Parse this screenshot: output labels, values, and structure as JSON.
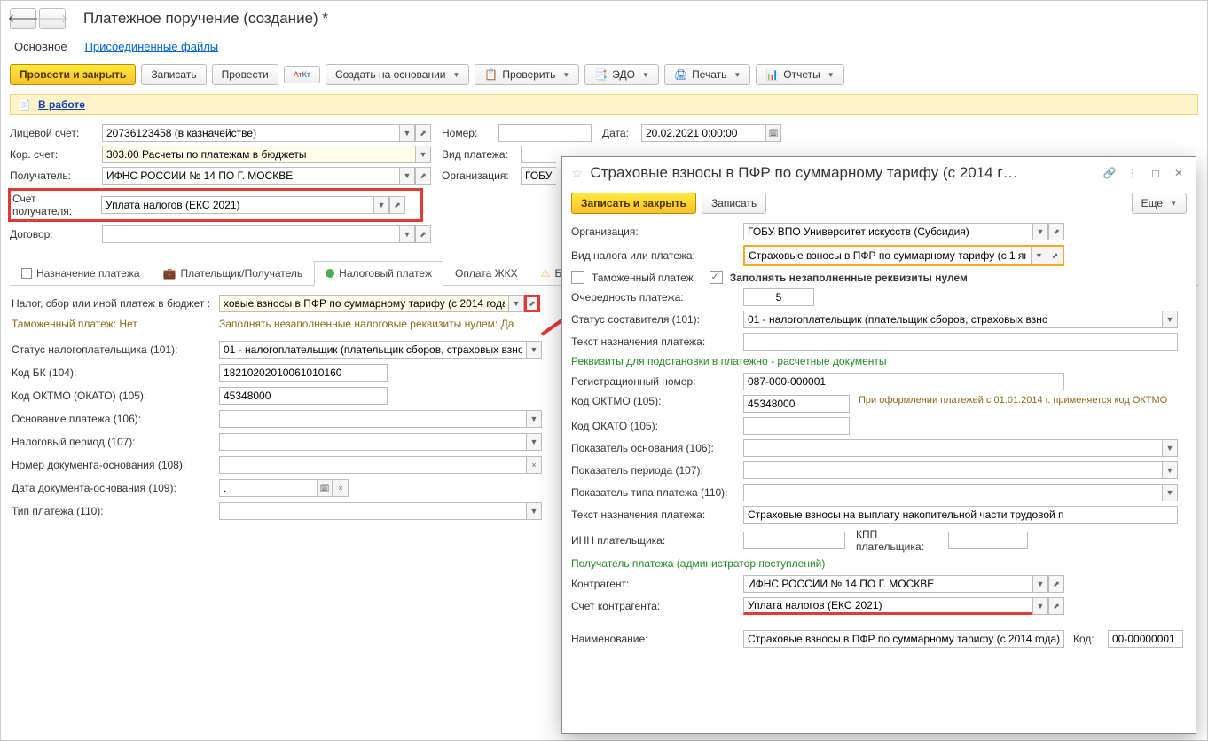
{
  "main": {
    "title": "Платежное поручение (создание) *",
    "subnav": {
      "main": "Основное",
      "files": "Присоединенные файлы"
    },
    "toolbar": {
      "submit": "Провести и закрыть",
      "save": "Записать",
      "post": "Провести",
      "create_on": "Создать на основании",
      "check": "Проверить",
      "edo": "ЭДО",
      "print": "Печать",
      "reports": "Отчеты"
    },
    "status": {
      "in_work": "В работе"
    },
    "form": {
      "account_lbl": "Лицевой счет:",
      "account": "20736123458 (в казначействе)",
      "number_lbl": "Номер:",
      "number": "",
      "date_lbl": "Дата:",
      "date": "20.02.2021 0:00:00",
      "koracc_lbl": "Кор. счет:",
      "koracc": "303.00 Расчеты по платежам в бюджеты",
      "paytype_lbl": "Вид платежа:",
      "paytype": "",
      "payee_lbl": "Получатель:",
      "payee": "ИФНС РОССИИ № 14 ПО Г. МОСКВЕ",
      "org_lbl": "Организация:",
      "org": "ГОБУ ВП",
      "payee_acc_lbl": "Счет получателя:",
      "payee_acc": "Уплата налогов (ЕКС 2021)",
      "contract_lbl": "Договор:",
      "contract": ""
    },
    "tabs": {
      "t1": "Назначение платежа",
      "t2": "Плательщик/Получатель",
      "t3": "Налоговый платеж",
      "t4": "Оплата ЖКХ",
      "t5": "Бу"
    },
    "taxtab": {
      "tax_lbl": "Налог, сбор или иной платеж в бюджет :",
      "tax": "ховые взносы в ПФР по суммарному тарифу (с 2014 года)",
      "customs_lbl": "Таможенный платеж:",
      "customs_val": "Нет",
      "fill_lbl": "Заполнять незаполненные налоговые реквизиты нулем:",
      "fill_val": "Да",
      "status101_lbl": "Статус налогоплательщика (101):",
      "status101": "01 - налогоплательщик (плательщик сборов, страховых взнос",
      "kbk_lbl": "Код БК (104):",
      "kbk": "18210202010061010160",
      "oktmo_lbl": "Код ОКТМО (ОКАТО) (105):",
      "oktmo": "45348000",
      "basis_lbl": "Основание платежа (106):",
      "basis": "",
      "period_lbl": "Налоговый период (107):",
      "period": "",
      "docnum_lbl": "Номер документа-основания (108):",
      "docnum": "",
      "docdate_lbl": "Дата документа-основания (109):",
      "docdate": ". .",
      "type110_lbl": "Тип платежа (110):",
      "type110": ""
    }
  },
  "popup": {
    "title": "Страховые взносы в ПФР по суммарному тарифу (с 2014 г…",
    "toolbar": {
      "submit": "Записать и закрыть",
      "save": "Записать",
      "more": "Еще"
    },
    "org_lbl": "Организация:",
    "org": "ГОБУ ВПО Университет искусств (Субсидия)",
    "taxtype_lbl": "Вид налога или платежа:",
    "taxtype": "Страховые взносы в ПФР по суммарному тарифу (с 1 янв",
    "customs_lbl": "Таможенный платеж",
    "fillzero_lbl": "Заполнять незаполненные реквизиты нулем",
    "priority_lbl": "Очередность платежа:",
    "priority": "5",
    "status_lbl": "Статус составителя (101):",
    "status": "01 - налогоплательщик (плательщик сборов, страховых взно",
    "purpose_text_lbl": "Текст назначения платежа:",
    "purpose_text": "",
    "section1": "Реквизиты для подстановки в платежно - расчетные документы",
    "regnum_lbl": "Регистрационный номер:",
    "regnum": "087-000-000001",
    "oktmo_lbl": "Код ОКТМО (105):",
    "oktmo": "45348000",
    "oktmo_hint": "При оформлении платежей с 01.01.2014 г. применяется код ОКТМО",
    "okato_lbl": "Код ОКАТО (105):",
    "okato": "",
    "basis_lbl": "Показатель основания (106):",
    "basis": "",
    "period_lbl": "Показатель периода (107):",
    "period": "",
    "type_lbl": "Показатель типа платежа (110):",
    "type": "",
    "purpose2_lbl": "Текст назначения платежа:",
    "purpose2": "Страховые взносы на выплату накопительной части трудовой п",
    "inn_lbl": "ИНН плательщика:",
    "inn": "",
    "kpp_lbl": "КПП плательщика:",
    "kpp": "",
    "section2": "Получатель платежа (администратор поступлений)",
    "contragent_lbl": "Контрагент:",
    "contragent": "ИФНС РОССИИ № 14 ПО Г. МОСКВЕ",
    "contragent_acc_lbl": "Счет контрагента:",
    "contragent_acc": "Уплата налогов (ЕКС 2021)",
    "name_lbl": "Наименование:",
    "name": "Страховые взносы в ПФР по суммарному тарифу (с 2014 года)",
    "code_lbl": "Код:",
    "code": "00-00000001"
  }
}
